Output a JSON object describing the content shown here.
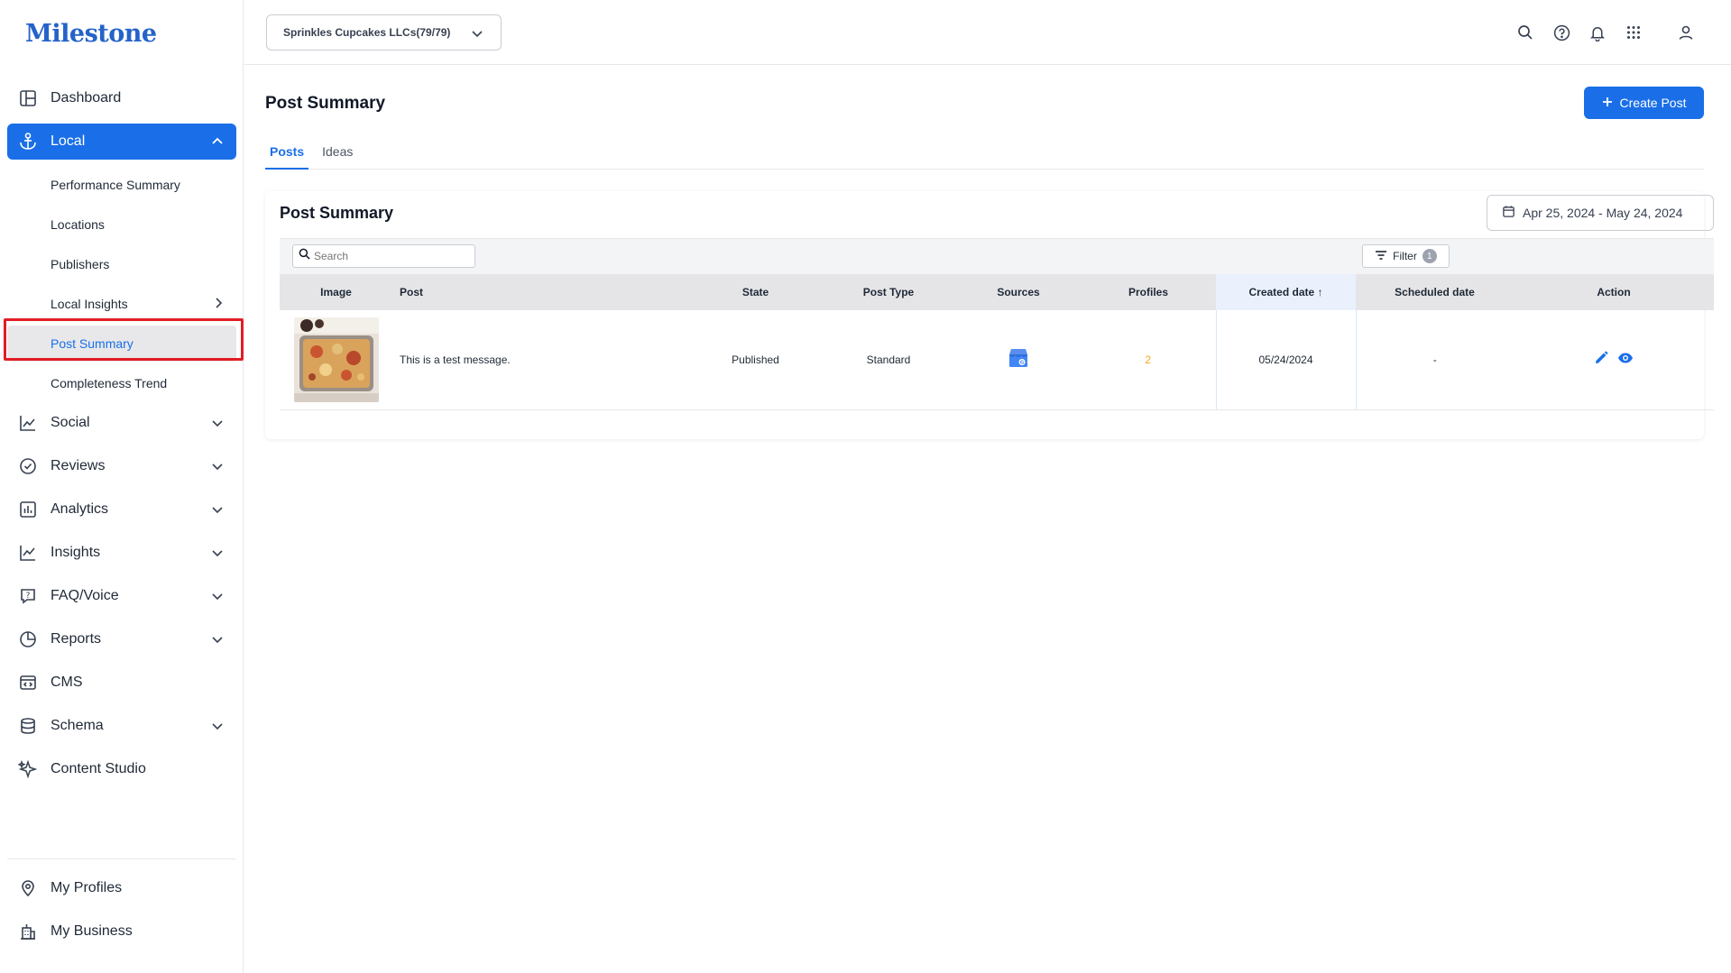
{
  "brand": {
    "logo_text": "Milestone",
    "accent": "#1a6fe8"
  },
  "sidebar": {
    "items": [
      {
        "label": "Dashboard",
        "icon": "dashboard-icon"
      },
      {
        "label": "Local",
        "icon": "anchor-icon",
        "expanded": true,
        "children": [
          {
            "label": "Performance Summary"
          },
          {
            "label": "Locations"
          },
          {
            "label": "Publishers"
          },
          {
            "label": "Local Insights"
          },
          {
            "label": "Post Summary",
            "active": true
          },
          {
            "label": "Completeness Trend"
          }
        ]
      },
      {
        "label": "Social",
        "icon": "trend-icon"
      },
      {
        "label": "Reviews",
        "icon": "check-circle-icon"
      },
      {
        "label": "Analytics",
        "icon": "bar-chart-icon"
      },
      {
        "label": "Insights",
        "icon": "line-chart-icon"
      },
      {
        "label": "FAQ/Voice",
        "icon": "faq-icon"
      },
      {
        "label": "Reports",
        "icon": "pie-chart-icon"
      },
      {
        "label": "CMS",
        "icon": "cms-icon"
      },
      {
        "label": "Schema",
        "icon": "database-icon"
      },
      {
        "label": "Content Studio",
        "icon": "sparkle-icon"
      }
    ],
    "bottom": [
      {
        "label": "My Profiles",
        "icon": "location-pin-icon"
      },
      {
        "label": "My Business",
        "icon": "building-icon"
      }
    ]
  },
  "topbar": {
    "account": "Sprinkles Cupcakes LLCs(79/79)",
    "icons": [
      "search-icon",
      "help-icon",
      "bell-icon",
      "apps-grid-icon",
      "user-icon"
    ]
  },
  "page": {
    "title": "Post Summary",
    "create_button": "Create Post",
    "tabs": [
      {
        "label": "Posts",
        "active": true
      },
      {
        "label": "Ideas"
      }
    ]
  },
  "card": {
    "title": "Post Summary",
    "date_range": "Apr 25, 2024 - May 24, 2024",
    "search_placeholder": "Search",
    "filter_label": "Filter",
    "filter_count": "1"
  },
  "table": {
    "columns": [
      "Image",
      "Post",
      "State",
      "Post Type",
      "Sources",
      "Profiles",
      "Created date ↑",
      "Scheduled date",
      "Action"
    ],
    "rows": [
      {
        "post": "This is a test message.",
        "state": "Published",
        "post_type": "Standard",
        "source_icon": "google-business-icon",
        "profiles": "2",
        "created": "05/24/2024",
        "scheduled": "-"
      }
    ]
  }
}
